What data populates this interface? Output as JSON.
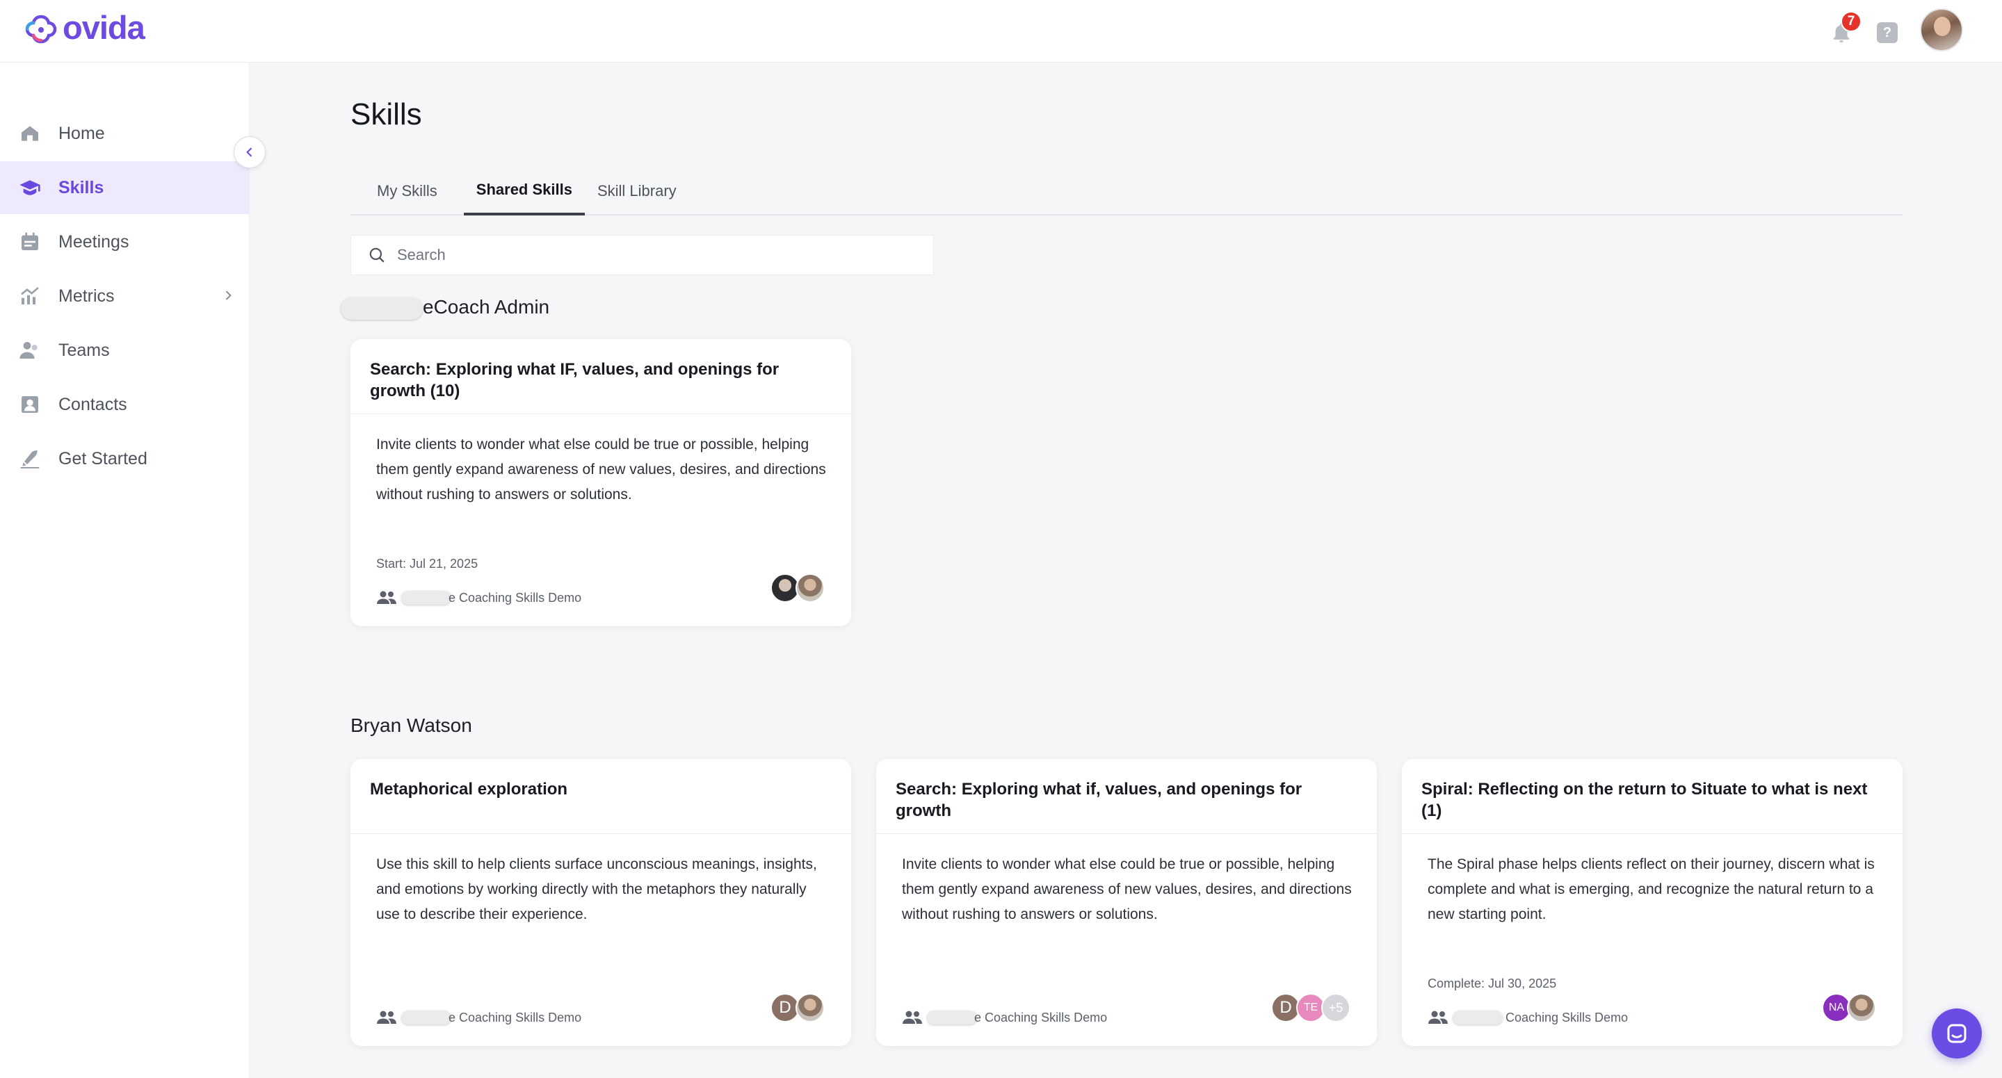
{
  "app": {
    "logo_text": "ovida",
    "brand_color": "#6d4ae0",
    "notification_count": "7",
    "help_label": "?"
  },
  "sidebar": {
    "items": [
      {
        "label": "Home",
        "icon": "home-icon"
      },
      {
        "label": "Skills",
        "icon": "graduation-cap-icon",
        "active": true
      },
      {
        "label": "Meetings",
        "icon": "calendar-icon"
      },
      {
        "label": "Metrics",
        "icon": "chart-icon",
        "expandable": true
      },
      {
        "label": "Teams",
        "icon": "people-icon"
      },
      {
        "label": "Contacts",
        "icon": "contact-icon"
      },
      {
        "label": "Get Started",
        "icon": "rocket-icon"
      }
    ]
  },
  "page": {
    "title": "Skills"
  },
  "tabs": [
    {
      "label": "My Skills"
    },
    {
      "label": "Shared Skills",
      "active": true
    },
    {
      "label": "Skill Library"
    }
  ],
  "search": {
    "placeholder": "Search"
  },
  "groups": [
    {
      "title": "eCoach Admin",
      "cards": [
        {
          "title": "Search: Exploring what IF, values, and openings for growth (10)",
          "description": "Invite clients to wonder what else could be true or possible, helping them gently expand awareness of new values, desires, and directions without rushing to answers or solutions.",
          "date": "Start: Jul 21, 2025",
          "team": "e Coaching Skills Demo",
          "avatars": [
            "photo",
            "photo"
          ]
        }
      ]
    },
    {
      "title": "Bryan Watson",
      "cards": [
        {
          "title": "Metaphorical exploration",
          "description": "Use this skill to help clients surface unconscious meanings, insights, and emotions by working directly with the metaphors they naturally use to describe their experience.",
          "date": "",
          "team": "e Coaching Skills Demo",
          "avatars": [
            "D",
            "photo"
          ]
        },
        {
          "title": "Search: Exploring what if, values, and openings for growth",
          "description": "Invite clients to wonder what else could be true or possible, helping them gently expand awareness of new values, desires, and directions without rushing to answers or solutions.",
          "date": "",
          "team": "e Coaching Skills Demo",
          "avatars": [
            "D",
            "TE",
            "+5"
          ]
        },
        {
          "title": "Spiral: Reflecting on the return to Situate to what is next (1)",
          "description": "The Spiral phase helps clients reflect on their journey, discern what is complete and what is emerging, and recognize the natural return to a new starting point.",
          "date": "Complete: Jul 30, 2025",
          "team": "Coaching Skills Demo",
          "avatars": [
            "NA",
            "photo"
          ]
        }
      ]
    }
  ]
}
